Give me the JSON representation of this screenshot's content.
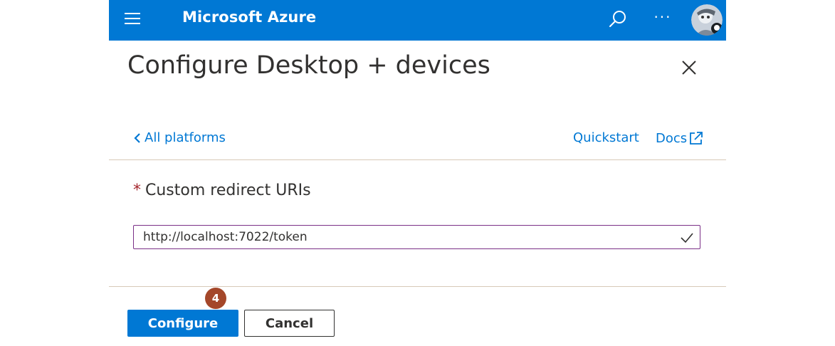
{
  "topbar": {
    "brand": "Microsoft Azure",
    "menu_icon": "hamburger-icon",
    "search_icon": "search-icon",
    "more_icon": "more-icon",
    "more_label": "···",
    "avatar_icon": "avatar"
  },
  "blade": {
    "title": "Configure Desktop + devices",
    "close_icon": "close-icon",
    "back_link": "All platforms",
    "quickstart_link": "Quickstart",
    "docs_link": "Docs"
  },
  "form": {
    "required_mark": "*",
    "label": "Custom redirect URIs",
    "value": "http://localhost:7022/token",
    "valid_icon": "checkmark-icon"
  },
  "footer": {
    "step_badge": "4",
    "configure_label": "Configure",
    "cancel_label": "Cancel"
  },
  "colors": {
    "accent": "#0078d4",
    "field_border": "#7a2f87",
    "badge": "#a4472a",
    "required": "#a4262c"
  }
}
